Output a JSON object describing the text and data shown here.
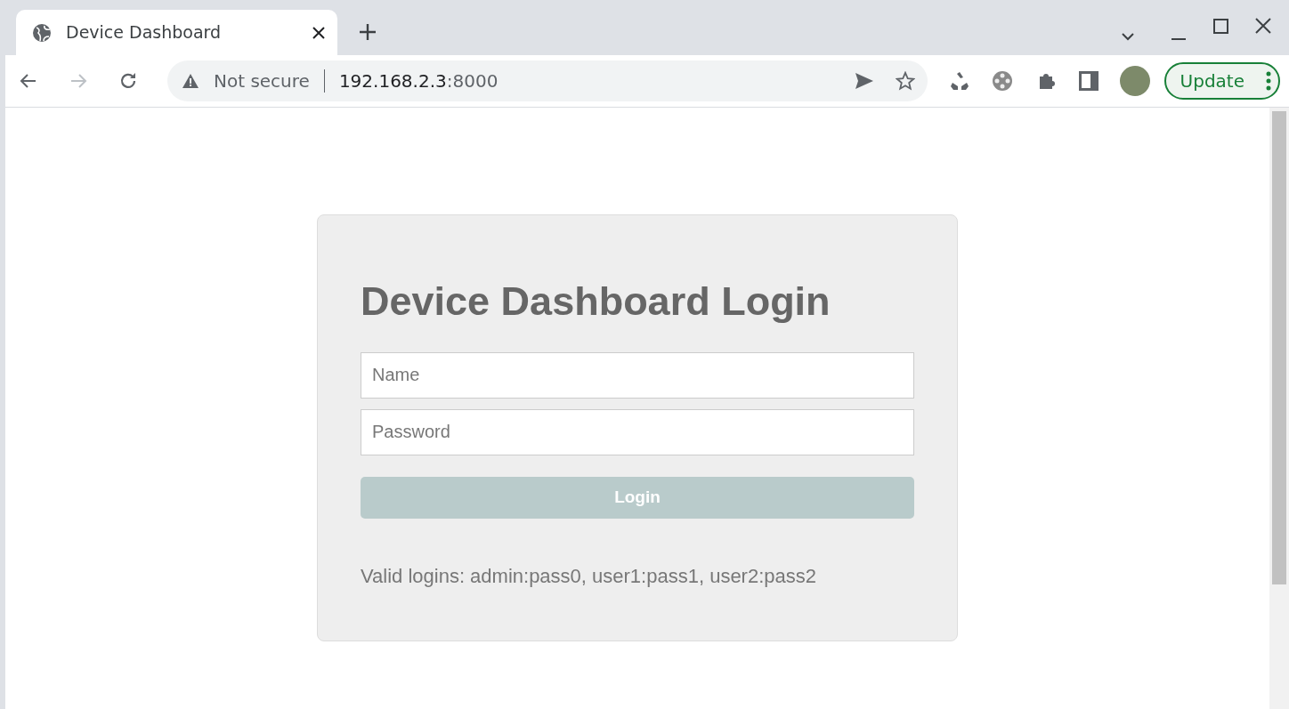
{
  "browser": {
    "tabs": [
      {
        "title": "Device Dashboard",
        "selected": true
      }
    ],
    "address": {
      "security": "Not secure",
      "host": "192.168.2.3",
      "port": ":8000"
    },
    "update_button": "Update"
  },
  "page": {
    "title": "Device Dashboard Login",
    "name_field": {
      "placeholder": "Name"
    },
    "password_field": {
      "placeholder": "Password"
    },
    "login_button": {
      "label": "Login",
      "disabled": true
    },
    "note": "Valid logins: admin:pass0, user1:pass1, user2:pass2"
  }
}
